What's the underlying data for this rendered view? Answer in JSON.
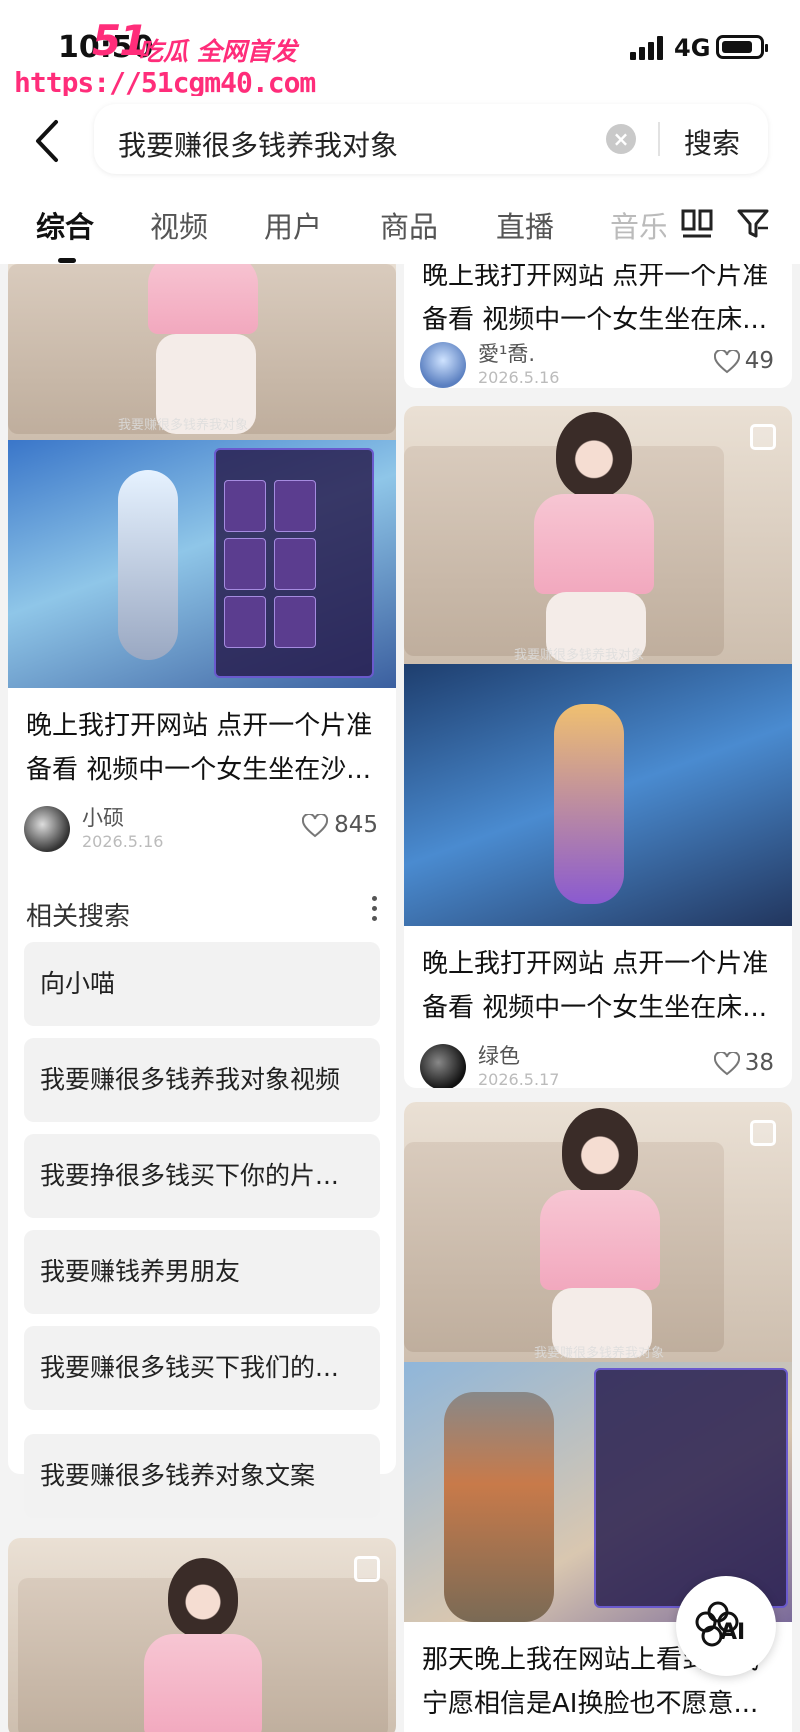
{
  "status_bar": {
    "time": "10:50",
    "network": "4G",
    "icons": [
      "signal-icon",
      "battery-icon"
    ]
  },
  "watermark": {
    "logo": "51",
    "text": "吃瓜 全网首发",
    "url": "https://51cgm40.com"
  },
  "search": {
    "query": "我要赚很多钱养我对象",
    "button_label": "搜索",
    "icons": [
      "back-icon",
      "clear-icon"
    ]
  },
  "tabs": {
    "items": [
      {
        "label": "综合",
        "active": true
      },
      {
        "label": "视频",
        "active": false
      },
      {
        "label": "用户",
        "active": false
      },
      {
        "label": "商品",
        "active": false
      },
      {
        "label": "直播",
        "active": false
      },
      {
        "label": "音乐",
        "active": false
      }
    ],
    "icons": [
      "layout-icon",
      "filter-icon"
    ]
  },
  "left_column": {
    "card1": {
      "video_caption": "我要赚很多钱养我对象",
      "title_line1": "晚上我打开网站 点开一个片准",
      "title_line2": "备看 视频中一个女生坐在沙...",
      "author": "小硕",
      "date": "2026.5.16",
      "likes": "845"
    },
    "related": {
      "title": "相关搜索",
      "items": [
        "向小喵",
        "我要赚很多钱养我对象视频",
        "我要挣很多钱买下你的片...",
        "我要赚钱养男朋友",
        "我要赚很多钱买下我们的...",
        "我要赚很多钱养对象文案"
      ]
    }
  },
  "right_column": {
    "card0": {
      "title_line1": "晚上我打开网站 点开一个片准",
      "title_line2": "备看 视频中一个女生坐在床...",
      "author": "愛¹喬.",
      "date": "2026.5.16",
      "likes": "49"
    },
    "card1": {
      "video_caption": "我要赚很多钱养我对象",
      "title_line1": "晚上我打开网站 点开一个片准",
      "title_line2": "备看 视频中一个女生坐在床...",
      "author": "绿色",
      "date": "2026.5.17",
      "likes": "38"
    },
    "card2": {
      "video_caption": "我要赚很多钱养我对象",
      "title_line1": "那天晚上我在网站上看到...我",
      "title_line2": "宁愿相信是AI换脸也不愿意..."
    }
  },
  "ai_button": {
    "label": "AI"
  }
}
